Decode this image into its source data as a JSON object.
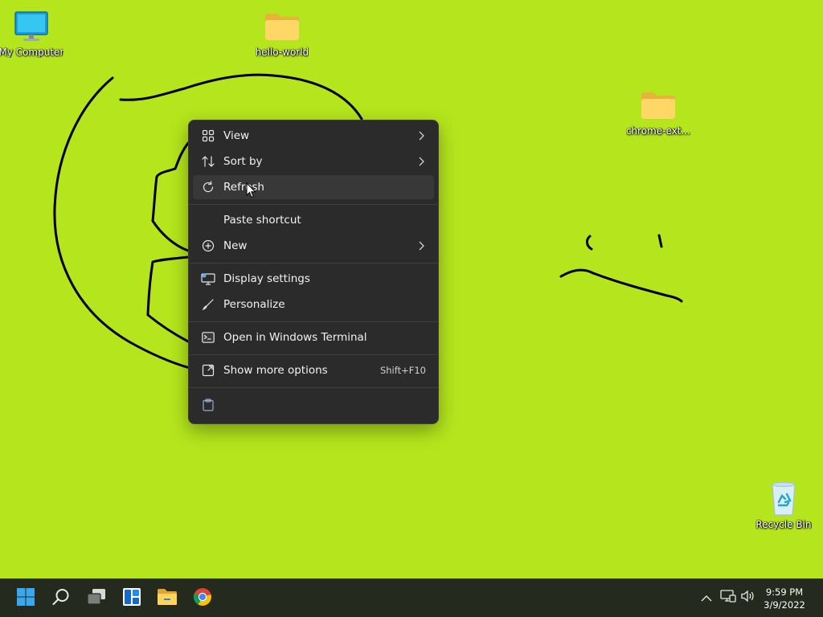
{
  "desktop": {
    "background_color": "#b5e61d",
    "icons": [
      {
        "name": "my-computer",
        "label": "My Computer",
        "icon": "monitor-icon"
      },
      {
        "name": "hello-world",
        "label": "hello-world",
        "icon": "folder-icon"
      },
      {
        "name": "chrome-ext",
        "label": "chrome-ext...",
        "icon": "folder-icon"
      },
      {
        "name": "recycle-bin",
        "label": "Recycle Bin",
        "icon": "recycle-bin-icon"
      }
    ]
  },
  "context_menu": {
    "items": [
      {
        "label": "View",
        "icon": "grid-icon",
        "submenu": true
      },
      {
        "label": "Sort by",
        "icon": "sort-icon",
        "submenu": true
      },
      {
        "label": "Refresh",
        "icon": "refresh-icon",
        "hovered": true
      },
      {
        "label": "Paste shortcut",
        "icon": ""
      },
      {
        "label": "New",
        "icon": "plus-circle-icon",
        "submenu": true
      },
      {
        "label": "Display settings",
        "icon": "display-icon"
      },
      {
        "label": "Personalize",
        "icon": "brush-icon"
      },
      {
        "label": "Open in Windows Terminal",
        "icon": "terminal-icon"
      },
      {
        "label": "Show more options",
        "icon": "more-options-icon",
        "shortcut": "Shift+F10"
      },
      {
        "label": "",
        "icon": "clipboard-icon"
      }
    ]
  },
  "taskbar": {
    "apps": [
      "start-icon",
      "search-icon",
      "task-view-icon",
      "widgets-icon",
      "file-explorer-icon",
      "chrome-icon"
    ],
    "tray": [
      "chevron-up-icon",
      "network-icon",
      "volume-icon"
    ],
    "time": "9:59 PM",
    "date": "3/9/2022"
  },
  "colors": {
    "menu_bg": "#2b2b2b",
    "menu_hover": "#383838",
    "taskbar_bg": "#242a1e",
    "accent_blue": "#0078d4"
  }
}
